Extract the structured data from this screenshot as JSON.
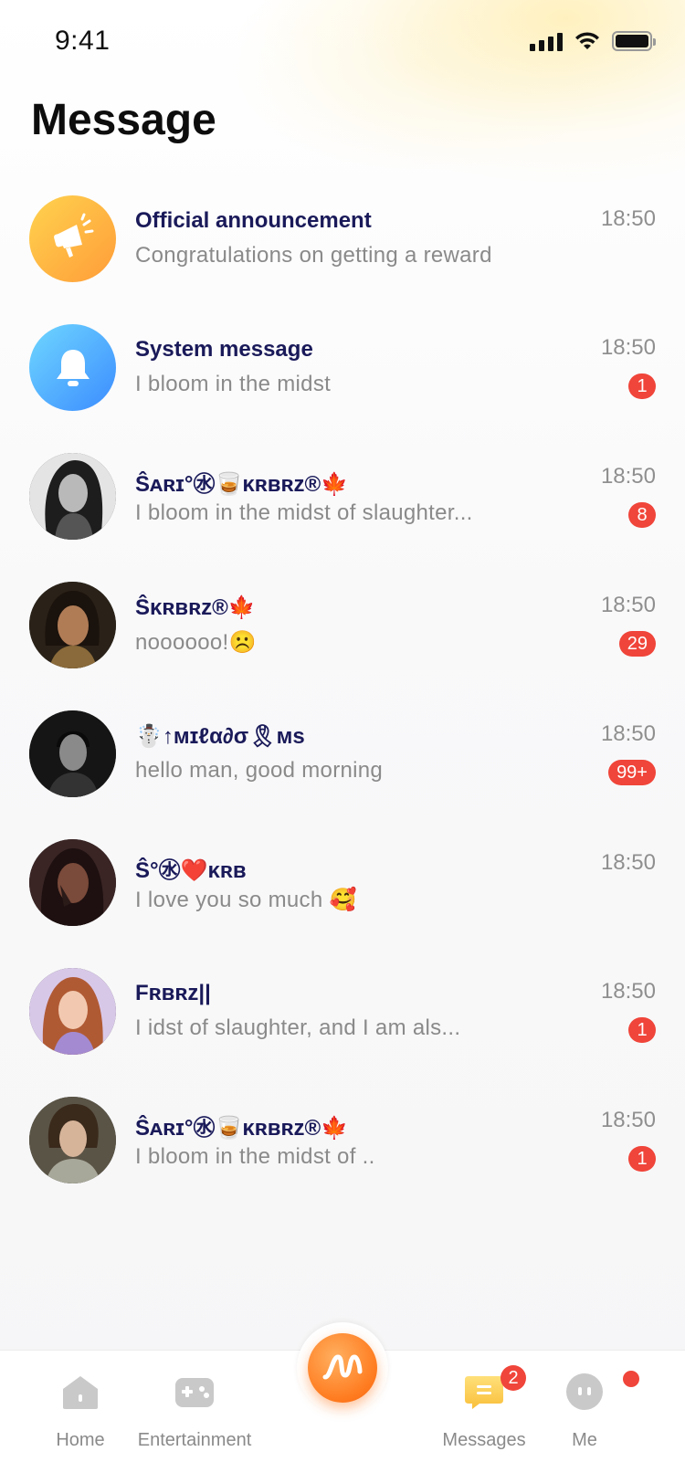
{
  "status_bar": {
    "time": "9:41"
  },
  "header": {
    "title": "Message"
  },
  "messages": [
    {
      "name": "Official announcement",
      "preview": "Congratulations on getting a reward",
      "time": "18:50",
      "badge": "",
      "avatar": "megaphone-icon"
    },
    {
      "name": "System message",
      "preview": "I bloom in the midst",
      "time": "18:50",
      "badge": "1",
      "avatar": "bell-icon"
    },
    {
      "name": "Ŝᴀʀɪ°㊌🥃ᴋʀʙʀᴢ®🍁",
      "preview": "I bloom in the midst of slaughter...",
      "time": "18:50",
      "badge": "8",
      "avatar": "user-photo"
    },
    {
      "name": "Ŝᴋʀʙʀᴢ®🍁",
      "preview": "noooooo!☹️",
      "time": "18:50",
      "badge": "29",
      "avatar": "user-photo"
    },
    {
      "name": "☃️↑ᴍɪℓα∂σ🎗ᴍs",
      "preview": "hello man,  good morning",
      "time": "18:50",
      "badge": "99+",
      "avatar": "user-photo"
    },
    {
      "name": "Ŝ°㊌❤️ᴋʀʙ",
      "preview": "I love you so much 🥰",
      "time": "18:50",
      "badge": "",
      "avatar": "user-photo"
    },
    {
      "name": "Fʀʙʀᴢ||",
      "preview": "I idst of slaughter, and I am als...",
      "time": "18:50",
      "badge": "1",
      "avatar": "user-photo"
    },
    {
      "name": "Ŝᴀʀɪ°㊌🥃ᴋʀʙʀᴢ®🍁",
      "preview": "I bloom in the midst of ..",
      "time": "18:50",
      "badge": "1",
      "avatar": "user-photo"
    }
  ],
  "tabs": [
    {
      "label": "Home",
      "icon": "home-icon"
    },
    {
      "label": "Entertainment",
      "icon": "gamepad-icon"
    },
    {
      "label": "",
      "icon": "app-logo-icon"
    },
    {
      "label": "Messages",
      "icon": "chat-icon",
      "badge": "2"
    },
    {
      "label": "Me",
      "icon": "profile-icon"
    }
  ],
  "colors": {
    "accent": "#f5c44a",
    "badge": "#f0453a",
    "name_text": "#1a1a5a",
    "secondary_text": "#8a8a8a"
  }
}
